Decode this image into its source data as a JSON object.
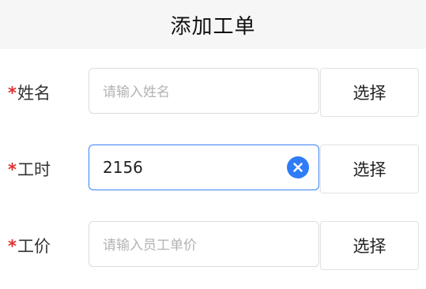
{
  "header": {
    "title": "添加工单"
  },
  "form": {
    "required_mark": "*",
    "rows": [
      {
        "label": "姓名",
        "value": "",
        "placeholder": "请输入姓名",
        "button": "选择"
      },
      {
        "label": "工时",
        "value": "2156",
        "placeholder": "",
        "button": "选择",
        "has_clear": true
      },
      {
        "label": "工价",
        "value": "",
        "placeholder": "请输入员工单价",
        "button": "选择"
      }
    ]
  },
  "colors": {
    "accent": "#2f7cf6",
    "required": "#e03030",
    "header_bg": "#f6f6f6"
  },
  "icons": {
    "clear": "clear-circle-icon"
  }
}
